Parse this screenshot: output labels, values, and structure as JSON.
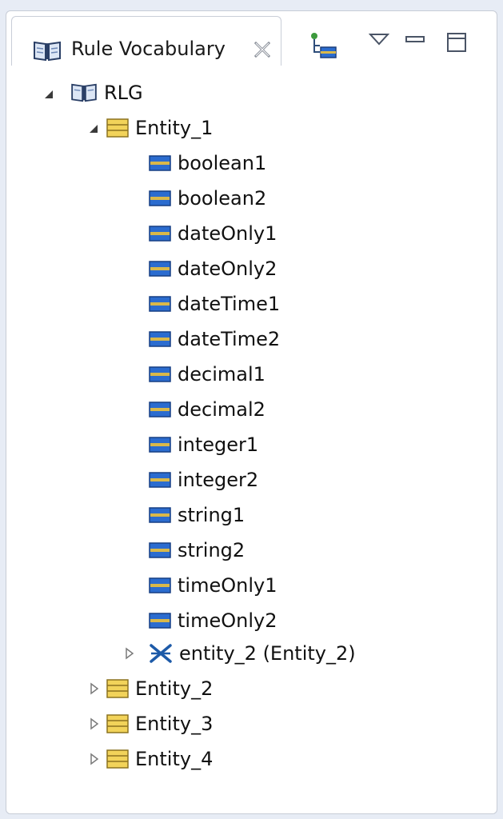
{
  "view": {
    "tab_label": "Rule Vocabulary",
    "toolbar": {
      "new_icon": "add-attribute-icon",
      "menu_icon": "view-menu-icon",
      "minimize_icon": "minimize-icon",
      "maximize_icon": "maximize-icon"
    }
  },
  "tree": {
    "root": {
      "label": "RLG",
      "icon": "vocabulary-book-icon",
      "expanded": true
    },
    "entities": [
      {
        "label": "Entity_1",
        "expanded": true,
        "attributes": [
          "boolean1",
          "boolean2",
          "dateOnly1",
          "dateOnly2",
          "dateTime1",
          "dateTime2",
          "decimal1",
          "decimal2",
          "integer1",
          "integer2",
          "string1",
          "string2",
          "timeOnly1",
          "timeOnly2"
        ],
        "associations": [
          {
            "label": "entity_2 (Entity_2)",
            "expanded": false
          }
        ]
      },
      {
        "label": "Entity_2",
        "expanded": false
      },
      {
        "label": "Entity_3",
        "expanded": false
      },
      {
        "label": "Entity_4",
        "expanded": false
      }
    ]
  },
  "colors": {
    "background": "#e7ecf5",
    "panel": "#ffffff",
    "entity_icon": "#f2d35a",
    "attribute_icon": "#2b6ccf",
    "association_icon": "#1d5aa8"
  }
}
